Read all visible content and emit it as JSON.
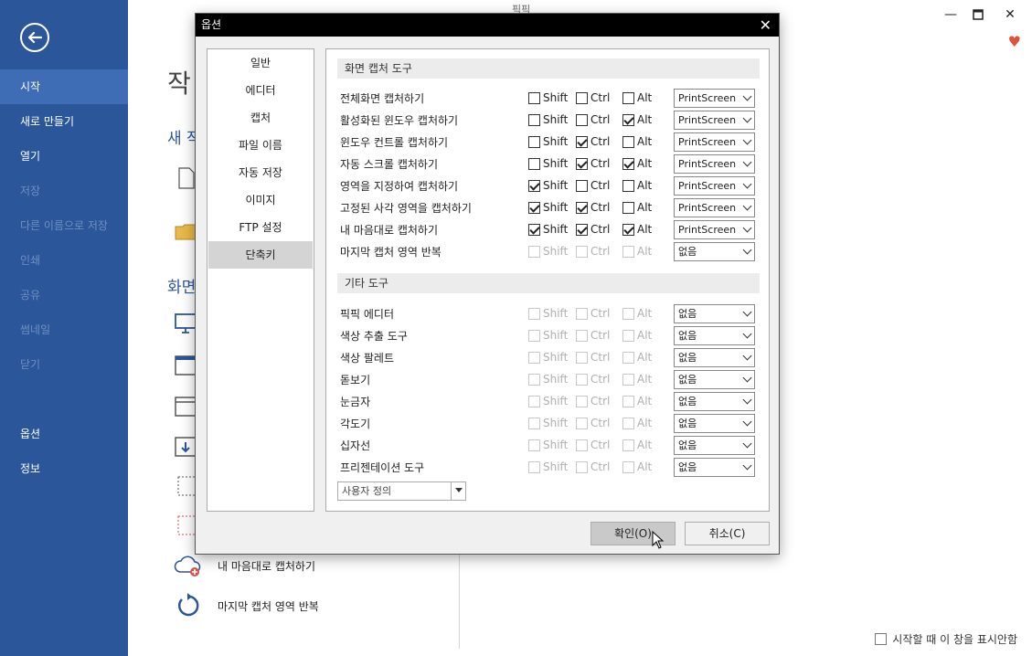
{
  "app": {
    "title": "픽픽"
  },
  "sidebar": {
    "items": [
      {
        "label": "시작",
        "state": "active"
      },
      {
        "label": "새로 만들기",
        "state": "normal"
      },
      {
        "label": "열기",
        "state": "normal"
      },
      {
        "label": "저장",
        "state": "disabled"
      },
      {
        "label": "다른 이름으로 저장",
        "state": "disabled"
      },
      {
        "label": "인쇄",
        "state": "disabled"
      },
      {
        "label": "공유",
        "state": "disabled"
      },
      {
        "label": "썸네일",
        "state": "disabled"
      },
      {
        "label": "닫기",
        "state": "disabled"
      },
      {
        "label": "옵션",
        "state": "normal"
      },
      {
        "label": "정보",
        "state": "normal"
      }
    ]
  },
  "background": {
    "heading": "작",
    "sub1": "새 작",
    "sub2": "화면",
    "rows": [
      {
        "label": "내 마음대로 캡처하기",
        "icon": "cloud-plus-icon"
      },
      {
        "label": "마지막 캡처 영역 반복",
        "icon": "repeat-icon"
      }
    ],
    "startup_label": "시작할 때 이 창을 표시안함"
  },
  "dialog": {
    "title": "옵션",
    "categories": [
      {
        "label": "일반",
        "active": false
      },
      {
        "label": "에디터",
        "active": false
      },
      {
        "label": "캡처",
        "active": false
      },
      {
        "label": "파일 이름",
        "active": false
      },
      {
        "label": "자동 저장",
        "active": false
      },
      {
        "label": "이미지",
        "active": false
      },
      {
        "label": "FTP 설정",
        "active": false
      },
      {
        "label": "단축키",
        "active": true
      }
    ],
    "capture_section": "화면 캡처 도구",
    "other_section": "기타 도구",
    "labels": {
      "shift": "Shift",
      "ctrl": "Ctrl",
      "alt": "Alt"
    },
    "capture_rows": [
      {
        "label": "전체화면 캡처하기",
        "shift": false,
        "ctrl": false,
        "alt": false,
        "key": "PrintScreen",
        "enabled": true
      },
      {
        "label": "활성화된 윈도우 캡처하기",
        "shift": false,
        "ctrl": false,
        "alt": true,
        "key": "PrintScreen",
        "enabled": true
      },
      {
        "label": "윈도우 컨트롤 캡처하기",
        "shift": false,
        "ctrl": true,
        "alt": false,
        "key": "PrintScreen",
        "enabled": true
      },
      {
        "label": "자동 스크롤 캡처하기",
        "shift": false,
        "ctrl": true,
        "alt": true,
        "key": "PrintScreen",
        "enabled": true
      },
      {
        "label": "영역을 지정하여 캡처하기",
        "shift": true,
        "ctrl": false,
        "alt": false,
        "key": "PrintScreen",
        "enabled": true
      },
      {
        "label": "고정된 사각 영역을 캡처하기",
        "shift": true,
        "ctrl": true,
        "alt": false,
        "key": "PrintScreen",
        "enabled": true
      },
      {
        "label": "내 마음대로 캡처하기",
        "shift": true,
        "ctrl": true,
        "alt": true,
        "key": "PrintScreen",
        "enabled": true
      },
      {
        "label": "마지막 캡처 영역 반복",
        "shift": false,
        "ctrl": false,
        "alt": false,
        "key": "없음",
        "enabled": false
      }
    ],
    "other_rows": [
      {
        "label": "픽픽 에디터",
        "key": "없음"
      },
      {
        "label": "색상 추출 도구",
        "key": "없음"
      },
      {
        "label": "색상 팔레트",
        "key": "없음"
      },
      {
        "label": "돋보기",
        "key": "없음"
      },
      {
        "label": "눈금자",
        "key": "없음"
      },
      {
        "label": "각도기",
        "key": "없음"
      },
      {
        "label": "십자선",
        "key": "없음"
      },
      {
        "label": "프리젠테이션 도구",
        "key": "없음"
      }
    ],
    "custom_select": "사용자 정의",
    "ok_label": "확인(O)",
    "cancel_label": "취소(C)"
  },
  "colors": {
    "sidebar": "#2b579a",
    "sidebar_active": "#3e6db5",
    "heart": "#e0533b"
  }
}
